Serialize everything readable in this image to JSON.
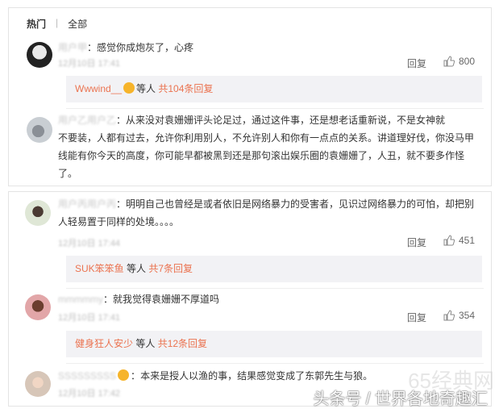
{
  "tabs": {
    "hot": "热门",
    "sep": "|",
    "all": "全部"
  },
  "comments": [
    {
      "name": "用户甲",
      "sep": "：",
      "text": "感觉你成炮灰了，心疼",
      "time": "12月10日 17:41",
      "reply": "回复",
      "likes": "800",
      "sub": {
        "user": "Wwwind__",
        "mid": "等人 ",
        "count": "共104条回复"
      }
    },
    {
      "name": "用户乙用户乙",
      "sep": "：",
      "lines": [
        "从来没对袁姗姗评头论足过，通过这件事，还是想老话重新说，不是女神就",
        "不要装，人都有过去，允许你利用别人，不允许别人和你有一点点的关系。讲道理好伐，你没马甲",
        "线能有你今天的高度，你可能早都被黑到还是那句滚出娱乐圈的袁姗姗了，人丑，就不要多作怪",
        "了。"
      ]
    },
    {
      "name": "用户丙用户丙",
      "sep": "：",
      "lines": [
        "明明自己也曾经是或者依旧是网络暴力的受害者，见识过网络暴力的可怕，却把别",
        "人轻易置于同样的处境。。。。"
      ],
      "time": "12月10日 17:44",
      "reply": "回复",
      "likes": "451",
      "sub": {
        "user": "SUK笨笨鱼",
        "mid": " 等人 ",
        "count": "共7条回复"
      }
    },
    {
      "name": "mmmmmy",
      "sep": "：",
      "text": "就我觉得袁姗姗不厚道吗",
      "time": "12月10日 17:41",
      "reply": "回复",
      "likes": "354",
      "sub": {
        "user": "健身狂人安少",
        "mid": " 等人 ",
        "count": "共12条回复"
      }
    },
    {
      "name": "SSSSSSSSS",
      "sep": "：",
      "text": "本来是授人以渔的事，结果感觉变成了东郭先生与狼。",
      "time": "12月10日 17:42"
    }
  ],
  "watermark": {
    "big": "65经典网",
    "small": "头条号 / 世界各地奇趣汇"
  },
  "colors": {
    "username": "#eb7350",
    "sub_bg": "#f2f2f5",
    "text": "#333333",
    "muted": "#666666"
  }
}
